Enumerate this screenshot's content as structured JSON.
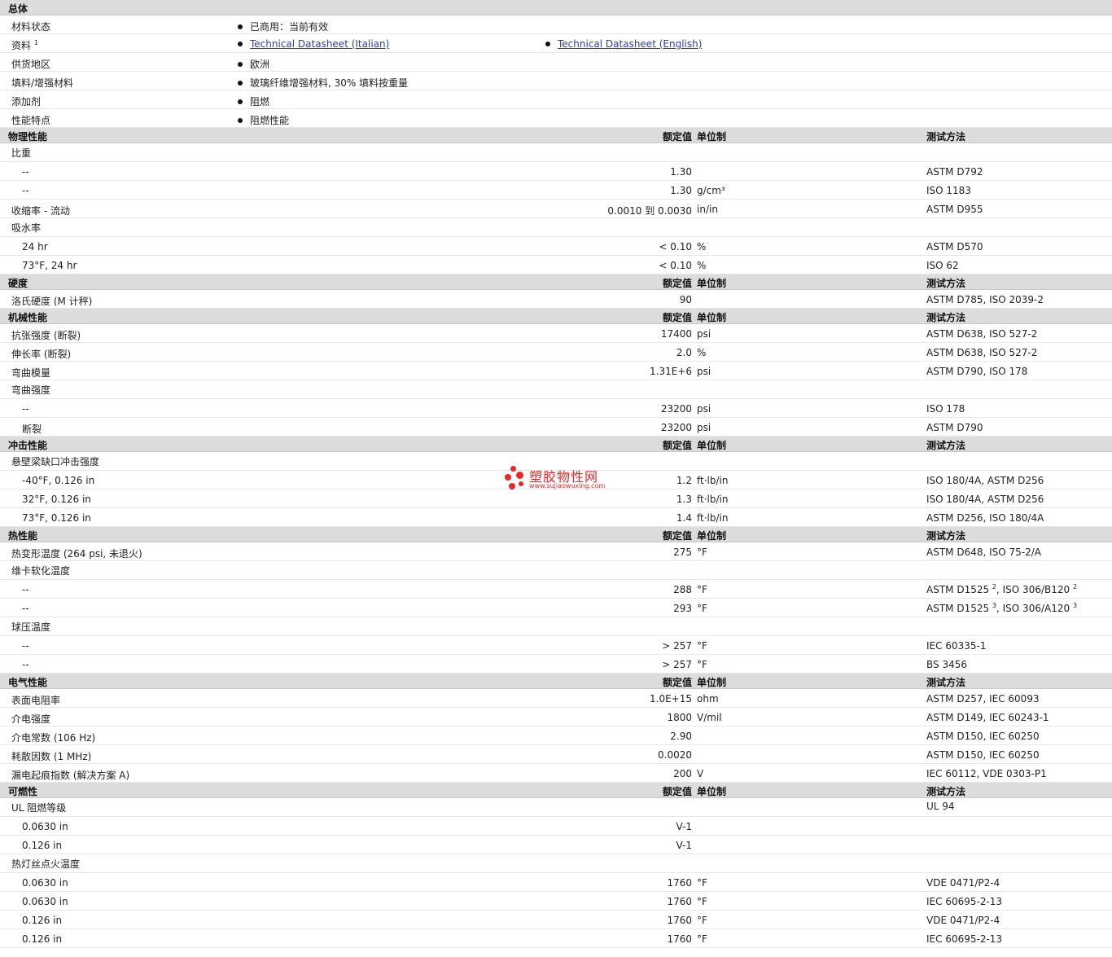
{
  "general": {
    "title": "总体",
    "rows": [
      {
        "label": "材料状态",
        "items": [
          {
            "text": "已商用：当前有效"
          }
        ]
      },
      {
        "label": "资料",
        "sup": "1",
        "items": [
          {
            "text": "Technical Datasheet (Italian)",
            "link": true
          },
          {
            "text": "Technical Datasheet (English)",
            "link": true
          }
        ]
      },
      {
        "label": "供货地区",
        "items": [
          {
            "text": "欧洲"
          }
        ]
      },
      {
        "label": "填料/增强材料",
        "items": [
          {
            "text": "玻璃纤维增强材料, 30% 填料按重量"
          }
        ]
      },
      {
        "label": "添加剂",
        "items": [
          {
            "text": "阻燃"
          }
        ]
      },
      {
        "label": "性能特点",
        "items": [
          {
            "text": "阻燃性能"
          }
        ]
      }
    ]
  },
  "headers": {
    "value": "额定值",
    "unit": "单位制",
    "method": "测试方法"
  },
  "sections": [
    {
      "title": "物理性能",
      "rows": [
        {
          "kind": "sub",
          "label": "比重"
        },
        {
          "kind": "data",
          "indent": true,
          "label": "--",
          "value": "1.30",
          "unit": "",
          "method": "ASTM D792"
        },
        {
          "kind": "data",
          "indent": true,
          "label": "--",
          "value": "1.30",
          "unit": "g/cm³",
          "method": "ISO 1183"
        },
        {
          "kind": "data",
          "label": "收缩率 - 流动",
          "value": "0.0010 到 0.0030",
          "unit": "in/in",
          "method": "ASTM D955"
        },
        {
          "kind": "sub",
          "label": "吸水率"
        },
        {
          "kind": "data",
          "indent": true,
          "label": "24 hr",
          "value": "< 0.10",
          "unit": "%",
          "method": "ASTM D570"
        },
        {
          "kind": "data",
          "indent": true,
          "label": "73°F, 24 hr",
          "value": "< 0.10",
          "unit": "%",
          "method": "ISO 62"
        }
      ]
    },
    {
      "title": "硬度",
      "rows": [
        {
          "kind": "data",
          "label": "洛氏硬度 (M 计秤)",
          "value": "90",
          "unit": "",
          "method": "ASTM D785, ISO 2039-2"
        }
      ]
    },
    {
      "title": "机械性能",
      "rows": [
        {
          "kind": "data",
          "label": "抗张强度 (断裂)",
          "value": "17400",
          "unit": "psi",
          "method": "ASTM D638, ISO 527-2"
        },
        {
          "kind": "data",
          "label": "伸长率 (断裂)",
          "value": "2.0",
          "unit": "%",
          "method": "ASTM D638, ISO 527-2"
        },
        {
          "kind": "data",
          "label": "弯曲模量",
          "value": "1.31E+6",
          "unit": "psi",
          "method": "ASTM D790, ISO 178"
        },
        {
          "kind": "sub",
          "label": "弯曲强度"
        },
        {
          "kind": "data",
          "indent": true,
          "label": "--",
          "value": "23200",
          "unit": "psi",
          "method": "ISO 178"
        },
        {
          "kind": "data",
          "indent": true,
          "label": "断裂",
          "value": "23200",
          "unit": "psi",
          "method": "ASTM D790"
        }
      ]
    },
    {
      "title": "冲击性能",
      "rows": [
        {
          "kind": "sub",
          "label": "悬壁梁缺口冲击强度"
        },
        {
          "kind": "data",
          "indent": true,
          "label": "-40°F, 0.126 in",
          "value": "1.2",
          "unit": "ft·lb/in",
          "method": "ISO 180/4A, ASTM D256"
        },
        {
          "kind": "data",
          "indent": true,
          "label": "32°F, 0.126 in",
          "value": "1.3",
          "unit": "ft·lb/in",
          "method": "ISO 180/4A, ASTM D256"
        },
        {
          "kind": "data",
          "indent": true,
          "label": "73°F, 0.126 in",
          "value": "1.4",
          "unit": "ft·lb/in",
          "method": "ASTM D256, ISO 180/4A"
        }
      ]
    },
    {
      "title": "热性能",
      "rows": [
        {
          "kind": "data",
          "label": "热变形温度 (264 psi, 未退火)",
          "value": "275",
          "unit": "°F",
          "method": "ASTM D648, ISO 75-2/A"
        },
        {
          "kind": "sub",
          "label": "维卡软化温度"
        },
        {
          "kind": "data",
          "indent": true,
          "label": "--",
          "value": "288",
          "unit": "°F",
          "method_parts": [
            {
              "t": "ASTM D1525 "
            },
            {
              "sup": "2"
            },
            {
              "t": ", ISO 306/B120 "
            },
            {
              "sup": "2"
            }
          ]
        },
        {
          "kind": "data",
          "indent": true,
          "label": "--",
          "value": "293",
          "unit": "°F",
          "method_parts": [
            {
              "t": "ASTM D1525 "
            },
            {
              "sup": "3"
            },
            {
              "t": ", ISO 306/A120 "
            },
            {
              "sup": "3"
            }
          ]
        },
        {
          "kind": "sub",
          "label": "球压温度"
        },
        {
          "kind": "data",
          "indent": true,
          "label": "--",
          "value": "> 257",
          "unit": "°F",
          "method": "IEC 60335-1"
        },
        {
          "kind": "data",
          "indent": true,
          "label": "--",
          "value": "> 257",
          "unit": "°F",
          "method": "BS 3456"
        }
      ]
    },
    {
      "title": "电气性能",
      "rows": [
        {
          "kind": "data",
          "label": "表面电阻率",
          "value": "1.0E+15",
          "unit": "ohm",
          "method": "ASTM D257, IEC 60093"
        },
        {
          "kind": "data",
          "label": "介电强度",
          "value": "1800",
          "unit": "V/mil",
          "method": "ASTM D149, IEC 60243-1"
        },
        {
          "kind": "data",
          "label": "介电常数 (106 Hz)",
          "value": "2.90",
          "unit": "",
          "method": "ASTM D150, IEC 60250"
        },
        {
          "kind": "data",
          "label": "耗散因数 (1 MHz)",
          "value": "0.0020",
          "unit": "",
          "method": "ASTM D150, IEC 60250"
        },
        {
          "kind": "data",
          "label": "漏电起痕指数 (解决方案 A)",
          "value": "200",
          "unit": "V",
          "method": "IEC 60112, VDE 0303-P1"
        }
      ]
    },
    {
      "title": "可燃性",
      "rows": [
        {
          "kind": "sub",
          "label": "UL 阻燃等级",
          "method": "UL 94"
        },
        {
          "kind": "data",
          "indent": true,
          "label": "0.0630 in",
          "value": "V-1",
          "unit": "",
          "method": ""
        },
        {
          "kind": "data",
          "indent": true,
          "label": "0.126 in",
          "value": "V-1",
          "unit": "",
          "method": ""
        },
        {
          "kind": "sub",
          "label": "热灯丝点火温度"
        },
        {
          "kind": "data",
          "indent": true,
          "label": "0.0630 in",
          "value": "1760",
          "unit": "°F",
          "method": "VDE 0471/P2-4"
        },
        {
          "kind": "data",
          "indent": true,
          "label": "0.0630 in",
          "value": "1760",
          "unit": "°F",
          "method": "IEC 60695-2-13"
        },
        {
          "kind": "data",
          "indent": true,
          "label": "0.126 in",
          "value": "1760",
          "unit": "°F",
          "method": "VDE 0471/P2-4"
        },
        {
          "kind": "data",
          "indent": true,
          "label": "0.126 in",
          "value": "1760",
          "unit": "°F",
          "method": "IEC 60695-2-13"
        }
      ]
    }
  ],
  "watermark": {
    "title": "塑胶物性网",
    "url": "www.sujiaowuxing.com",
    "color": "#e8292a"
  }
}
